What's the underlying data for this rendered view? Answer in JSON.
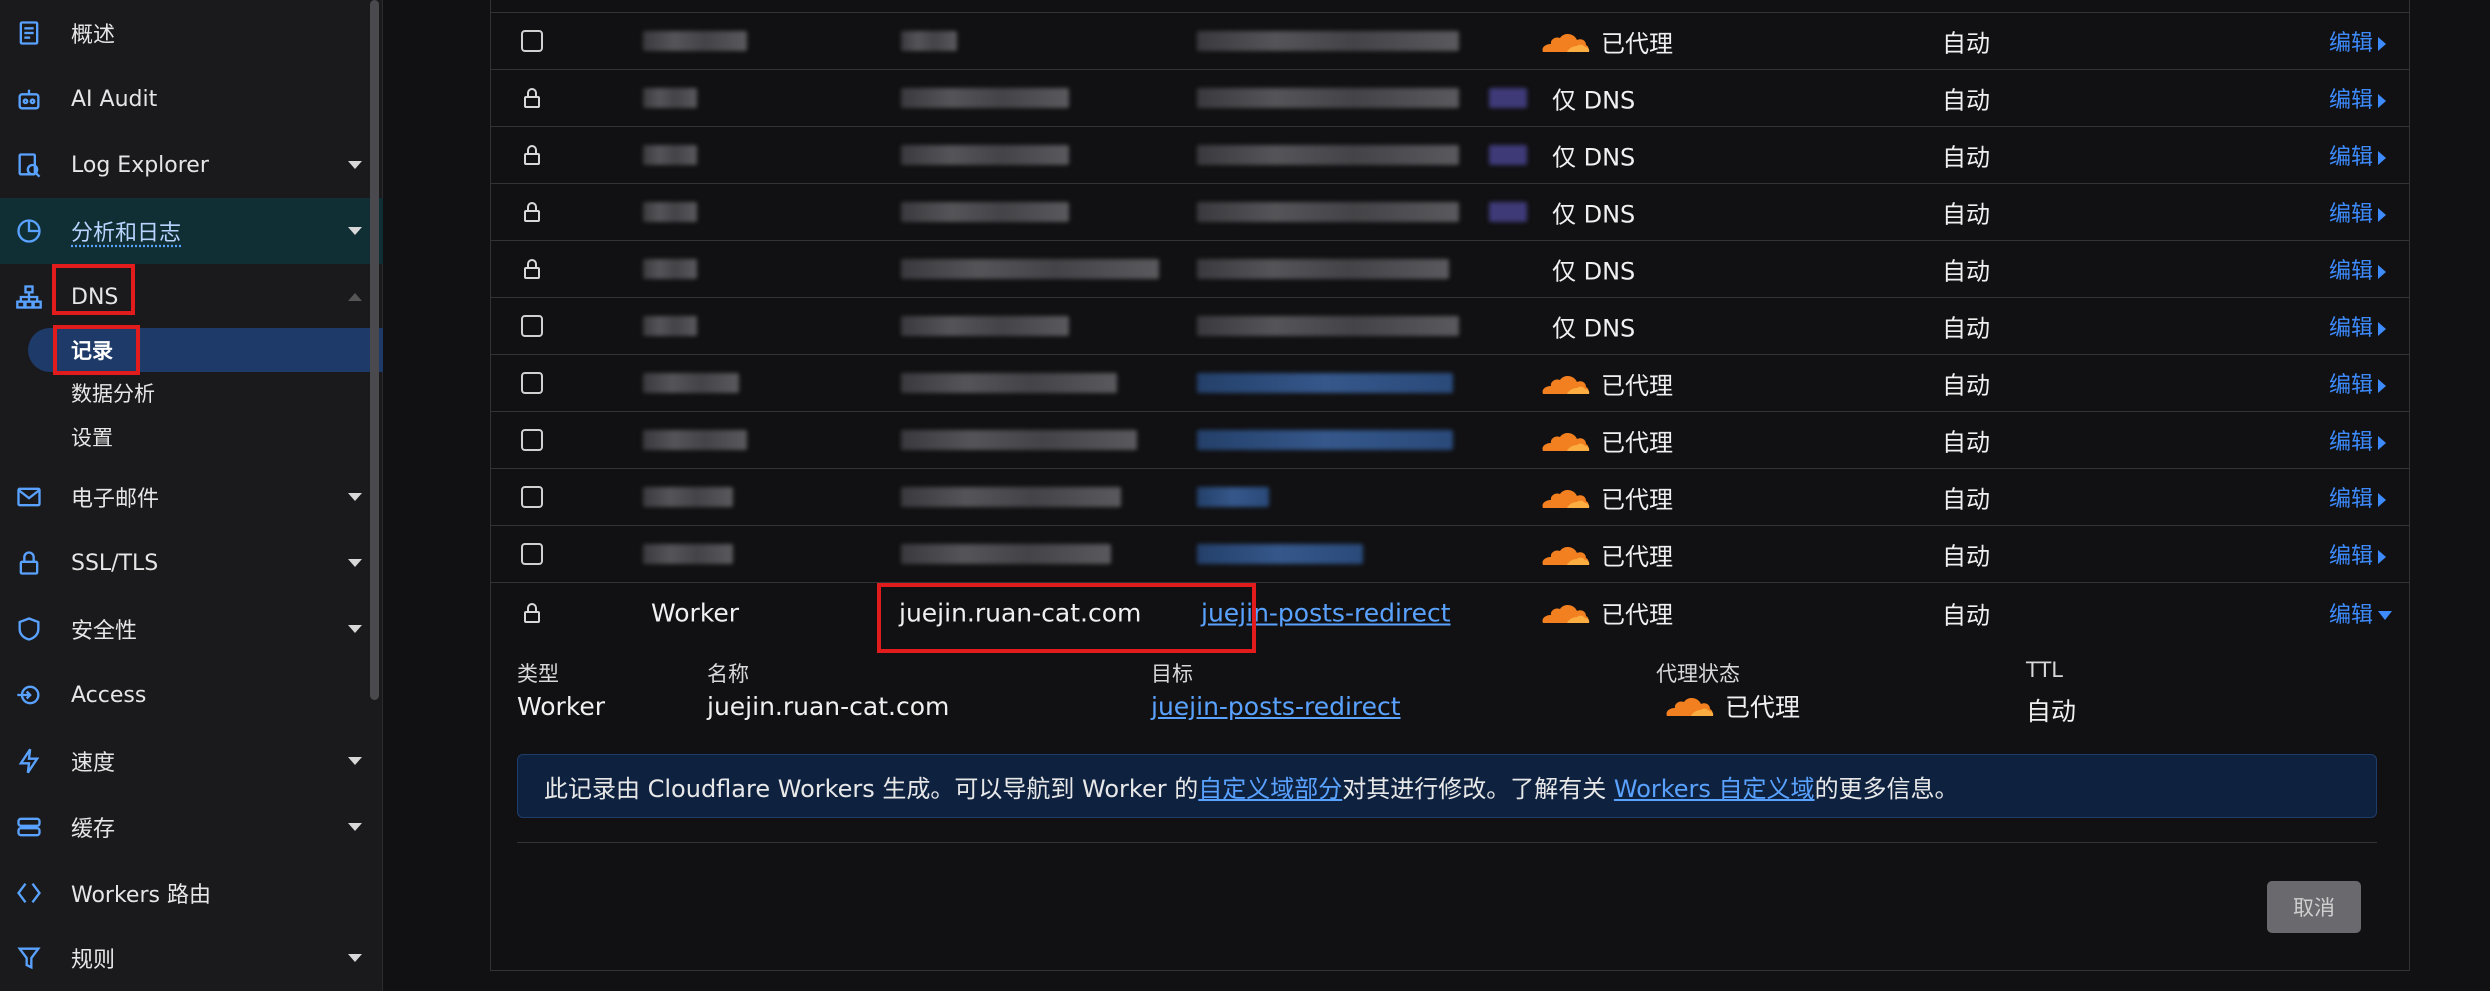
{
  "sidebar": {
    "items": [
      {
        "label": "概述",
        "icon": "document-icon"
      },
      {
        "label": "AI Audit",
        "icon": "robot-icon"
      },
      {
        "label": "Log Explorer",
        "icon": "log-explorer-icon"
      },
      {
        "label": "分析和日志",
        "icon": "pie-chart-icon"
      },
      {
        "label": "DNS",
        "icon": "sitemap-icon"
      },
      {
        "label": "电子邮件",
        "icon": "email-icon"
      },
      {
        "label": "SSL/TLS",
        "icon": "lock-icon"
      },
      {
        "label": "安全性",
        "icon": "shield-icon"
      },
      {
        "label": "Access",
        "icon": "access-icon"
      },
      {
        "label": "速度",
        "icon": "lightning-icon"
      },
      {
        "label": "缓存",
        "icon": "database-icon"
      },
      {
        "label": "Workers 路由",
        "icon": "workers-icon"
      },
      {
        "label": "规则",
        "icon": "funnel-icon"
      }
    ],
    "dns_sub": [
      "记录",
      "数据分析",
      "设置"
    ]
  },
  "records": {
    "proxied_label": "已代理",
    "dns_only_label": "仅 DNS",
    "ttl_auto": "自动",
    "edit_label": "编辑",
    "rows": [
      {
        "status": "proxied"
      },
      {
        "status": "dns_only"
      },
      {
        "status": "dns_only"
      },
      {
        "status": "dns_only"
      },
      {
        "status": "dns_only"
      },
      {
        "status": "dns_only"
      },
      {
        "status": "proxied"
      },
      {
        "status": "proxied"
      },
      {
        "status": "proxied"
      },
      {
        "status": "proxied"
      }
    ],
    "worker_row": {
      "type": "Worker",
      "name": "juejin.ruan-cat.com",
      "target": "juejin-posts-redirect",
      "proxy": "已代理",
      "ttl": "自动"
    }
  },
  "details": {
    "labels": {
      "type": "类型",
      "name": "名称",
      "target": "目标",
      "proxy": "代理状态",
      "ttl": "TTL"
    },
    "values": {
      "type": "Worker",
      "name": "juejin.ruan-cat.com",
      "target": "juejin-posts-redirect",
      "proxy": "已代理",
      "ttl": "自动"
    },
    "info": {
      "part1": "此记录由 Cloudflare Workers 生成。可以导航到 Worker 的",
      "link1": "自定义域部分",
      "part2": "对其进行修改。了解有关 ",
      "link2": "Workers 自定义域",
      "part3": "的更多信息。"
    },
    "cancel": "取消"
  },
  "colors": {
    "accent": "#3d8bfd",
    "proxy_cloud": "#f38020",
    "highlight": "#e21c1c",
    "info_bg": "#0e2240"
  }
}
